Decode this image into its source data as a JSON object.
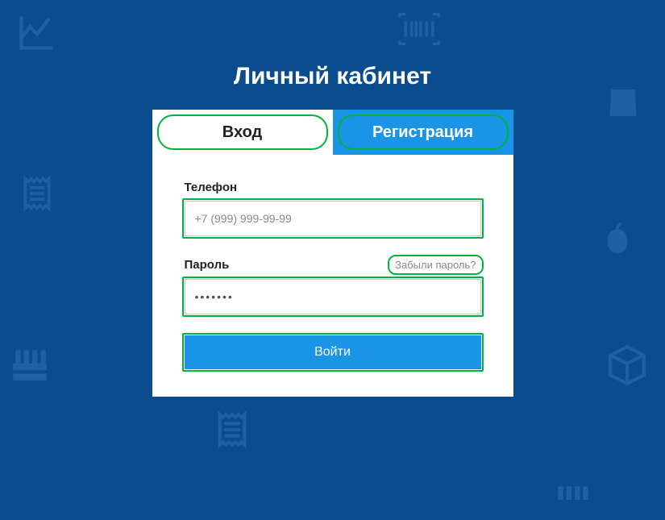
{
  "page_title": "Личный кабинет",
  "tabs": {
    "login": "Вход",
    "register": "Регистрация"
  },
  "form": {
    "phone_label": "Телефон",
    "phone_placeholder": "+7 (999) 999-99-99",
    "phone_value": "",
    "password_label": "Пароль",
    "password_value": "•••••••",
    "forgot_password": "Забыли пароль?",
    "submit_label": "Войти"
  }
}
